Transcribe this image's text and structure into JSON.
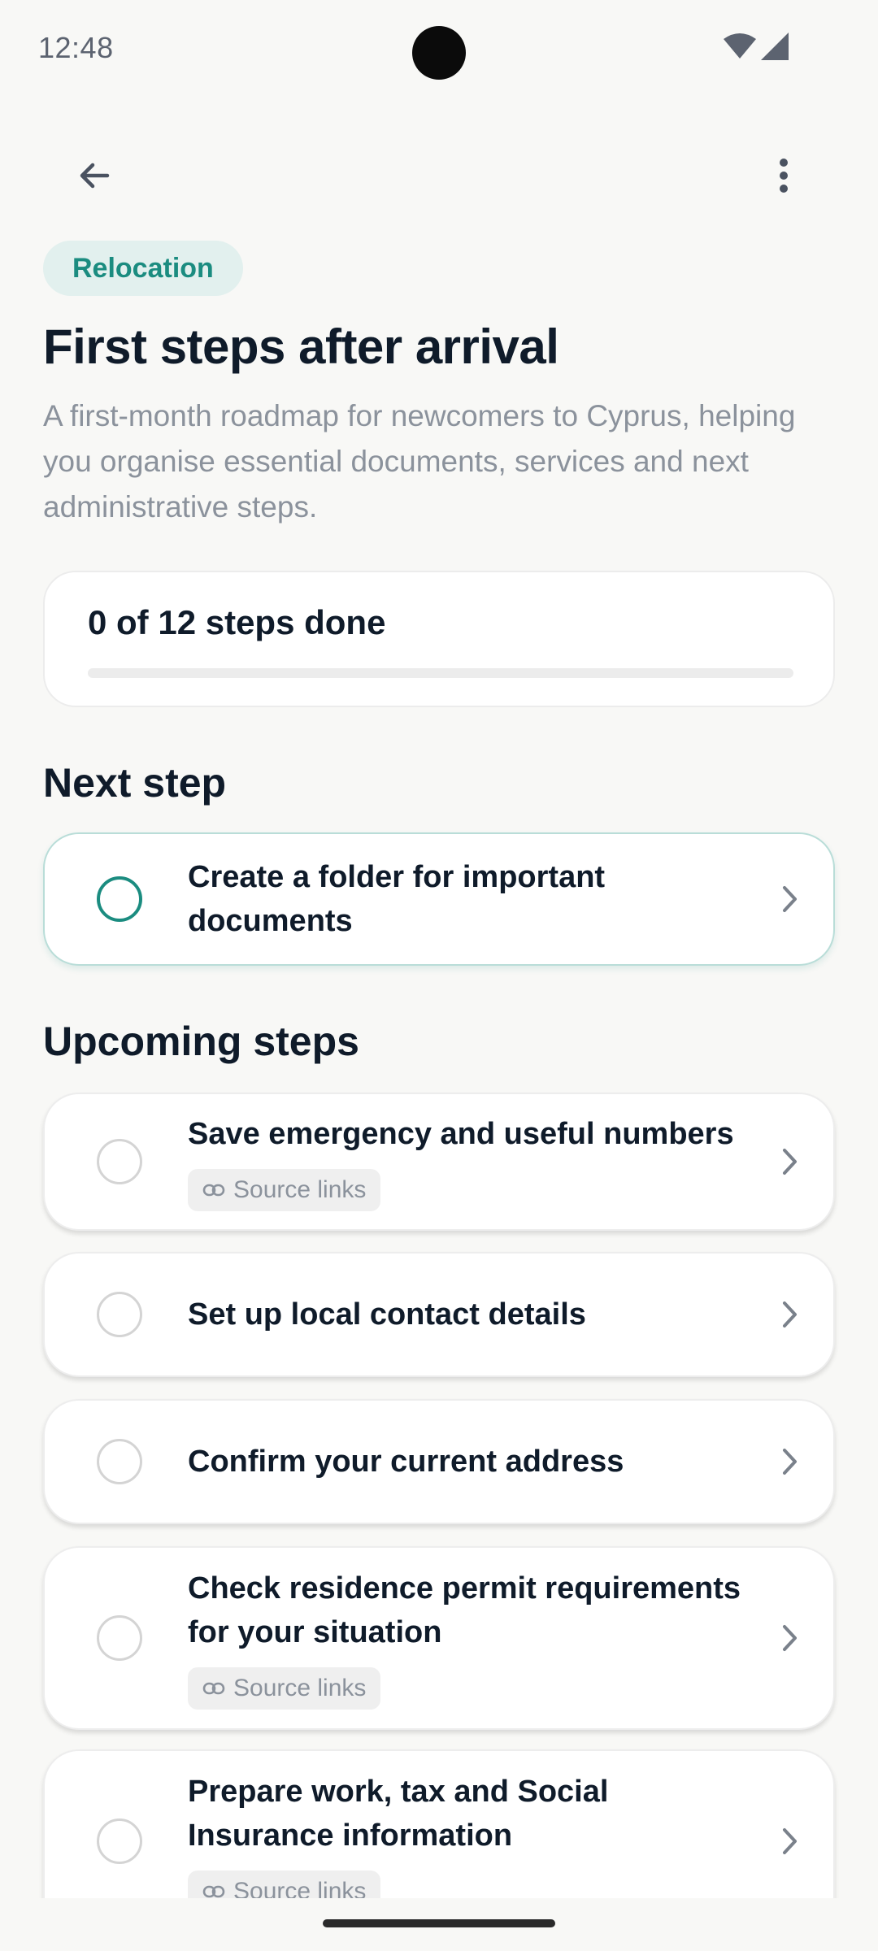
{
  "status_bar": {
    "time": "12:48"
  },
  "header": {
    "tag": "Relocation",
    "title": "First steps after arrival",
    "description": "A first-month roadmap for newcomers to Cyprus, helping you organise essential documents, services and next administrative steps."
  },
  "progress": {
    "label": "0 of 12 steps done",
    "done": 0,
    "total": 12
  },
  "next_step": {
    "section_title": "Next step",
    "title": "Create a folder for important documents"
  },
  "upcoming": {
    "section_title": "Upcoming steps",
    "source_label": "Source links",
    "items": [
      {
        "title": "Save emergency and useful numbers",
        "has_source": true
      },
      {
        "title": "Set up local contact details",
        "has_source": false
      },
      {
        "title": "Confirm your current address",
        "has_source": false
      },
      {
        "title": "Check residence permit requirements for your situation",
        "has_source": true
      },
      {
        "title": "Prepare work, tax and Social Insurance information",
        "has_source": true
      }
    ]
  },
  "icons": {
    "back": "arrow-back-icon",
    "menu": "more-vert-icon",
    "chevron": "chevron-right-icon",
    "link": "link-icon"
  },
  "colors": {
    "accent": "#1b8c80",
    "chip_bg": "#e2f0ee",
    "text": "#0f1b2a",
    "muted": "#8b929c"
  }
}
